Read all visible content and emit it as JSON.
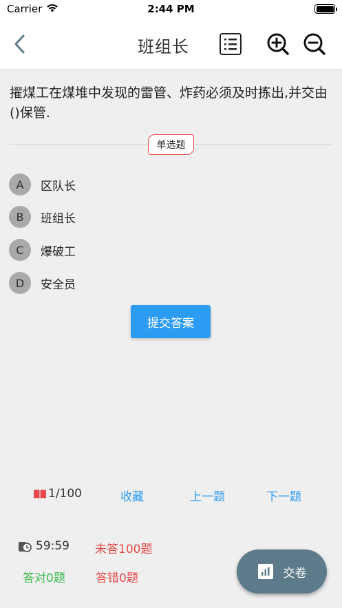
{
  "status_bar": {
    "carrier": "Carrier",
    "time": "2:44 PM"
  },
  "nav": {
    "title": "班组长"
  },
  "question": {
    "text": "擢煤工在煤堆中发现的雷管、炸药必须及时拣出,并交由()保管.",
    "type_label": "单选题"
  },
  "options": [
    {
      "letter": "A",
      "text": "区队长"
    },
    {
      "letter": "B",
      "text": "班组长"
    },
    {
      "letter": "C",
      "text": "爆破工"
    },
    {
      "letter": "D",
      "text": "安全员"
    }
  ],
  "submit_label": "提交答案",
  "bottom_nav": {
    "progress": "1/100",
    "favorite": "收藏",
    "prev": "上一题",
    "next": "下一题"
  },
  "stats": {
    "timer": "59:59",
    "unanswered": "未答100题",
    "correct": "答对0题",
    "wrong": "答错0题"
  },
  "submit_paper_label": "交卷",
  "colors": {
    "accent": "#2b9cf2",
    "error": "#e64a4a",
    "success": "#3cbd4f",
    "fab": "#5d7b8a"
  },
  "icons": {
    "back": "chevron-left-icon",
    "list": "list-icon",
    "zoom_in": "zoom-in-icon",
    "zoom_out": "zoom-out-icon",
    "progress": "book-icon",
    "timer": "clock-icon",
    "submit_paper": "chart-icon"
  }
}
